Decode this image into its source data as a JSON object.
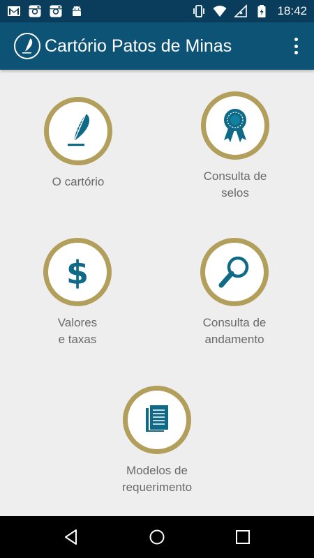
{
  "status_bar": {
    "left_icons": [
      "gmail-icon",
      "instagram-icon",
      "instagram-icon",
      "android-icon"
    ],
    "right_icons": [
      "vibrate-icon",
      "wifi-icon",
      "signal-icon",
      "battery-icon"
    ],
    "time": "18:42"
  },
  "app_bar": {
    "logo_icon": "quill-logo-icon",
    "title": "Cartório Patos de Minas",
    "menu_icon": "overflow-menu-icon"
  },
  "menu": {
    "items": [
      {
        "label": "O cartório",
        "icon": "quill-icon"
      },
      {
        "label": "Consulta de\nselos",
        "icon": "award-ribbon-icon"
      },
      {
        "label": "Valores\ne taxas",
        "icon": "dollar-icon"
      },
      {
        "label": "Consulta de\nandamento",
        "icon": "magnifier-icon"
      },
      {
        "label": "Modelos de\nrequerimento",
        "icon": "document-icon"
      }
    ]
  },
  "nav_bar": {
    "buttons": [
      "back-icon",
      "home-icon",
      "recents-icon"
    ]
  },
  "colors": {
    "status_bar": "#0a3d5c",
    "app_bar": "#0d5376",
    "ring_gold": "#b29f5b",
    "icon_teal": "#0e6a86",
    "background": "#eeeeee",
    "label": "#6a6a6a"
  }
}
